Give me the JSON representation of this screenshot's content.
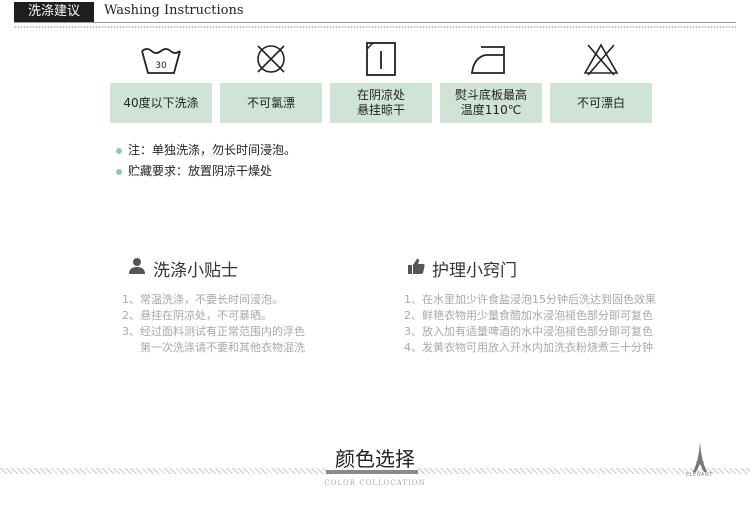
{
  "header": {
    "tag": "洗涤建议",
    "english": "Washing Instructions"
  },
  "wash_care": [
    {
      "icon": "wash-30-icon",
      "label_lines": [
        "40度以下洗涤"
      ]
    },
    {
      "icon": "no-chlorine-bleach-icon",
      "label_lines": [
        "不可氯漂"
      ]
    },
    {
      "icon": "line-dry-shade-icon",
      "label_lines": [
        "在阴凉处",
        "悬挂晾干"
      ]
    },
    {
      "icon": "iron-icon",
      "label_lines": [
        "熨斗底板最高",
        "温度110℃"
      ]
    },
    {
      "icon": "no-bleach-icon",
      "label_lines": [
        "不可漂白"
      ]
    }
  ],
  "wash_symbol_text": "30",
  "notes": [
    "注：单独洗涤，勿长时间浸泡。",
    "贮藏要求：放置阴凉干燥处"
  ],
  "tips": {
    "title": "洗涤小贴士",
    "items": [
      "1、常温洗涤，不要长时间浸泡。",
      "2、悬挂在阴凉处，不可暴晒。",
      "3、经过面料测试有正常范围内的浮色",
      "    第一次洗涤请不要和其他衣物混洗"
    ]
  },
  "care": {
    "title": "护理小窍门",
    "items": [
      "1、在水里加少许食盐浸泡15分钟后洗达到固色效果",
      "2、鲜艳衣物用少量食醋加水浸泡褪色部分即可复色",
      "3、放入加有适量啤酒的水中浸泡褪色部分即可复色",
      "4、发黄衣物可用放入开水内加洗衣粉烧煮三十分钟"
    ]
  },
  "footer": {
    "title": "颜色选择",
    "subtitle": "COLOR COLLOCATION",
    "brand": "ELEGANT"
  },
  "colors": {
    "label_bg": "#cfe3d6",
    "dot": "#9bc4ad",
    "header_bg": "#1e1e1e"
  }
}
